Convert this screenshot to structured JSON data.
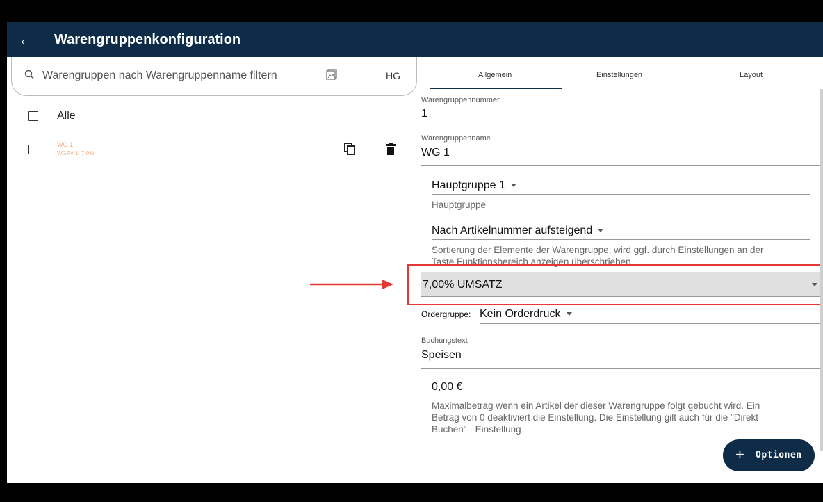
{
  "header": {
    "back_icon": "arrow-left-icon",
    "title": "Warengruppenkonfiguration"
  },
  "search": {
    "placeholder": "Warengruppen nach  Warengruppenname filtern",
    "hg_label": "HG"
  },
  "list": {
    "all_label": "Alle",
    "items": [
      {
        "title": "WG 1",
        "subtitle": "WGR# 1, 7,0%"
      }
    ]
  },
  "tabs": [
    "Allgemein",
    "Einstellungen",
    "Layout"
  ],
  "form": {
    "nummer_label": "Warengruppennummer",
    "nummer_value": "1",
    "name_label": "Warengruppenname",
    "name_value": "WG 1",
    "hauptgruppe_value": "Hauptgruppe 1",
    "hauptgruppe_hint": "Hauptgruppe",
    "sortierung_value": "Nach Artikelnummer aufsteigend",
    "sortierung_hint_1": "Sortierung der Elemente der Warengruppe, wird ggf. durch Einstellungen an der",
    "sortierung_hint_2": "Taste Funktionsbereich anzeigen überschrieben",
    "ust_value": "7,00% UMSATZ",
    "ordergruppe_label": "Ordergruppe:",
    "ordergruppe_value": "Kein Orderdruck",
    "buchungstext_label": "Buchungstext",
    "buchungstext_value": "Speisen",
    "betrag_value": "0,00 €",
    "betrag_hint_1": "Maximalbetrag wenn ein Artikel der dieser Warengruppe folgt gebucht wird. Ein",
    "betrag_hint_2": "Betrag von 0 deaktiviert die Einstellung. Die Einstellung gilt auch für die \"Direkt",
    "betrag_hint_3": "Buchen\" - Einstellung"
  },
  "fab": {
    "icon": "plus-icon",
    "label": "Optionen"
  },
  "colors": {
    "appbar": "#0e2b47",
    "navbar": "#1976d2",
    "highlight": "#e53935",
    "item_text": "#f4b183"
  }
}
